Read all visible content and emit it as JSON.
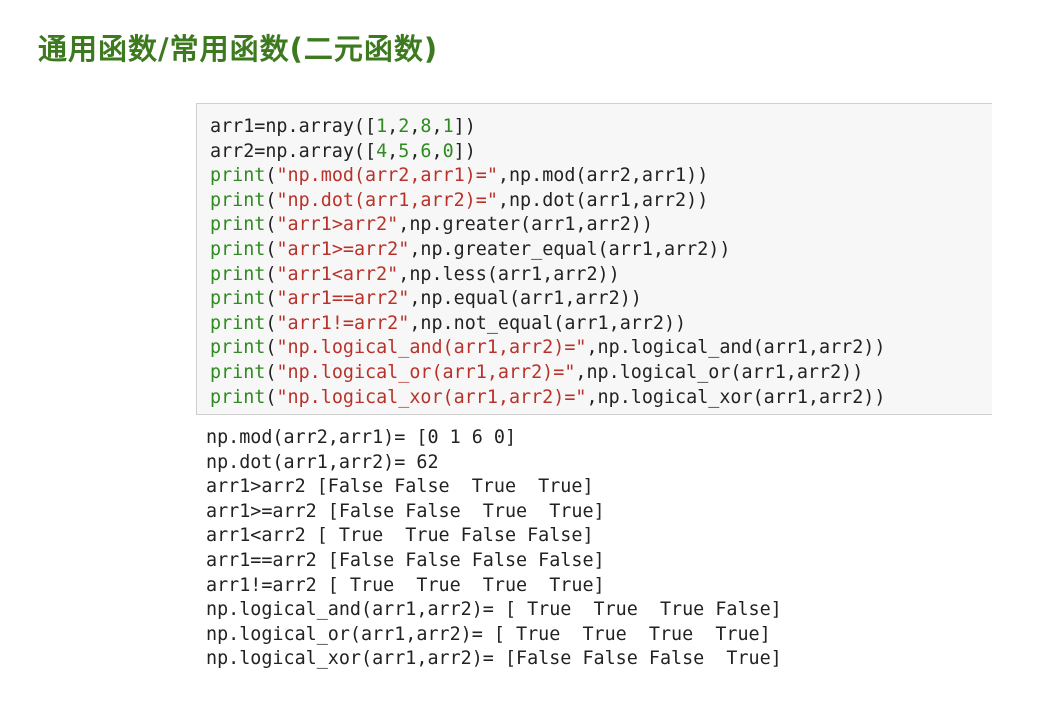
{
  "heading": "通用函数/常用函数(二元函数)",
  "colors": {
    "heading": "#3d7a1f",
    "keyword": "#2e8b20",
    "string": "#b8322a",
    "number": "#2e8b20",
    "text": "#222222",
    "cell_background": "#f7f7f7"
  },
  "code_lines": [
    [
      {
        "t": "plain",
        "v": "arr1=np.array(["
      },
      {
        "t": "num",
        "v": "1"
      },
      {
        "t": "plain",
        "v": ","
      },
      {
        "t": "num",
        "v": "2"
      },
      {
        "t": "plain",
        "v": ","
      },
      {
        "t": "num",
        "v": "8"
      },
      {
        "t": "plain",
        "v": ","
      },
      {
        "t": "num",
        "v": "1"
      },
      {
        "t": "plain",
        "v": "])"
      }
    ],
    [
      {
        "t": "plain",
        "v": "arr2=np.array(["
      },
      {
        "t": "num",
        "v": "4"
      },
      {
        "t": "plain",
        "v": ","
      },
      {
        "t": "num",
        "v": "5"
      },
      {
        "t": "plain",
        "v": ","
      },
      {
        "t": "num",
        "v": "6"
      },
      {
        "t": "plain",
        "v": ","
      },
      {
        "t": "num",
        "v": "0"
      },
      {
        "t": "plain",
        "v": "])"
      }
    ],
    [
      {
        "t": "kw",
        "v": "print"
      },
      {
        "t": "plain",
        "v": "("
      },
      {
        "t": "str",
        "v": "\"np.mod(arr2,arr1)=\""
      },
      {
        "t": "plain",
        "v": ",np.mod(arr2,arr1))"
      }
    ],
    [
      {
        "t": "kw",
        "v": "print"
      },
      {
        "t": "plain",
        "v": "("
      },
      {
        "t": "str",
        "v": "\"np.dot(arr1,arr2)=\""
      },
      {
        "t": "plain",
        "v": ",np.dot(arr1,arr2))"
      }
    ],
    [
      {
        "t": "kw",
        "v": "print"
      },
      {
        "t": "plain",
        "v": "("
      },
      {
        "t": "str",
        "v": "\"arr1>arr2\""
      },
      {
        "t": "plain",
        "v": ",np.greater(arr1,arr2))"
      }
    ],
    [
      {
        "t": "kw",
        "v": "print"
      },
      {
        "t": "plain",
        "v": "("
      },
      {
        "t": "str",
        "v": "\"arr1>=arr2\""
      },
      {
        "t": "plain",
        "v": ",np.greater_equal(arr1,arr2))"
      }
    ],
    [
      {
        "t": "kw",
        "v": "print"
      },
      {
        "t": "plain",
        "v": "("
      },
      {
        "t": "str",
        "v": "\"arr1<arr2\""
      },
      {
        "t": "plain",
        "v": ",np.less(arr1,arr2))"
      }
    ],
    [
      {
        "t": "kw",
        "v": "print"
      },
      {
        "t": "plain",
        "v": "("
      },
      {
        "t": "str",
        "v": "\"arr1==arr2\""
      },
      {
        "t": "plain",
        "v": ",np.equal(arr1,arr2))"
      }
    ],
    [
      {
        "t": "kw",
        "v": "print"
      },
      {
        "t": "plain",
        "v": "("
      },
      {
        "t": "str",
        "v": "\"arr1!=arr2\""
      },
      {
        "t": "plain",
        "v": ",np.not_equal(arr1,arr2))"
      }
    ],
    [
      {
        "t": "kw",
        "v": "print"
      },
      {
        "t": "plain",
        "v": "("
      },
      {
        "t": "str",
        "v": "\"np.logical_and(arr1,arr2)=\""
      },
      {
        "t": "plain",
        "v": ",np.logical_and(arr1,arr2))"
      }
    ],
    [
      {
        "t": "kw",
        "v": "print"
      },
      {
        "t": "plain",
        "v": "("
      },
      {
        "t": "str",
        "v": "\"np.logical_or(arr1,arr2)=\""
      },
      {
        "t": "plain",
        "v": ",np.logical_or(arr1,arr2))"
      }
    ],
    [
      {
        "t": "kw",
        "v": "print"
      },
      {
        "t": "plain",
        "v": "("
      },
      {
        "t": "str",
        "v": "\"np.logical_xor(arr1,arr2)=\""
      },
      {
        "t": "plain",
        "v": ",np.logical_xor(arr1,arr2))"
      }
    ]
  ],
  "output_lines": [
    "np.mod(arr2,arr1)= [0 1 6 0]",
    "np.dot(arr1,arr2)= 62",
    "arr1>arr2 [False False  True  True]",
    "arr1>=arr2 [False False  True  True]",
    "arr1<arr2 [ True  True False False]",
    "arr1==arr2 [False False False False]",
    "arr1!=arr2 [ True  True  True  True]",
    "np.logical_and(arr1,arr2)= [ True  True  True False]",
    "np.logical_or(arr1,arr2)= [ True  True  True  True]",
    "np.logical_xor(arr1,arr2)= [False False False  True]"
  ]
}
